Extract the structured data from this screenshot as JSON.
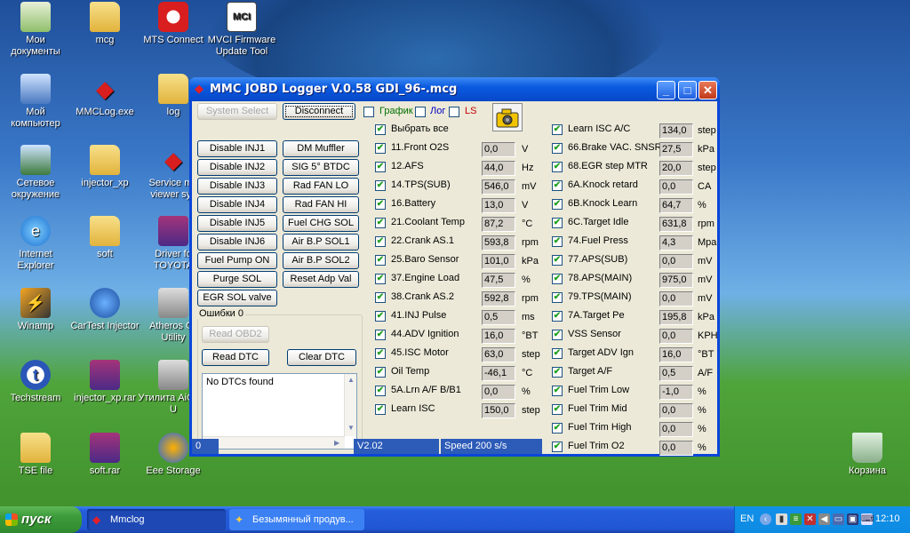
{
  "desktop": {
    "icons": [
      {
        "label": "Мои документы",
        "icon": "my-documents-icon"
      },
      {
        "label": "mcg",
        "icon": "folder-icon"
      },
      {
        "label": "MTS Connect",
        "icon": "mts-connect-icon"
      },
      {
        "label": "MVCI Firmware Update Tool",
        "icon": "mvci-icon"
      },
      {
        "label": "Мой компьютер",
        "icon": "my-computer-icon"
      },
      {
        "label": "MMCLog.exe",
        "icon": "mitsubishi-icon"
      },
      {
        "label": "log",
        "icon": "folder-icon"
      },
      {
        "label": "Сетевое окружение",
        "icon": "network-icon"
      },
      {
        "label": "injector_xp",
        "icon": "folder-icon"
      },
      {
        "label": "Service ma viewer sys",
        "icon": "mitsubishi-icon"
      },
      {
        "label": "Internet Explorer",
        "icon": "internet-explorer-icon"
      },
      {
        "label": "soft",
        "icon": "folder-icon"
      },
      {
        "label": "Driver fo TOYOTA",
        "icon": "archive-icon"
      },
      {
        "label": "Winamp",
        "icon": "winamp-icon"
      },
      {
        "label": "CarTest Injector",
        "icon": "cartest-icon"
      },
      {
        "label": "Atheros Cli Utility",
        "icon": "atheros-icon"
      },
      {
        "label": "Techstream",
        "icon": "techstream-icon"
      },
      {
        "label": "injector_xp.rar",
        "icon": "archive-icon"
      },
      {
        "label": "Утилита AiGuru U",
        "icon": "utility-icon"
      },
      {
        "label": "TSE file",
        "icon": "folder-icon"
      },
      {
        "label": "soft.rar",
        "icon": "archive-icon"
      },
      {
        "label": "Eee Storage",
        "icon": "eee-storage-icon"
      },
      {
        "label": "Корзина",
        "icon": "recycle-bin-icon"
      }
    ]
  },
  "window": {
    "title": "MMC JOBD Logger V.0.58 GDI_96-.mcg",
    "minimize": "_",
    "maximize": "□",
    "close": "✕",
    "system_select": "System Select",
    "disconnect": "Disconnect",
    "grafik": "График",
    "log": "Лог",
    "ls": "LS",
    "left_buttons": [
      "Disable INJ1",
      "Disable INJ2",
      "Disable INJ3",
      "Disable INJ4",
      "Disable INJ5",
      "Disable INJ6",
      "Fuel Pump ON",
      "Purge SOL",
      "EGR SOL valve"
    ],
    "mid_buttons": [
      "DM Muffler",
      "SIG 5° BTDC",
      "Rad FAN LO",
      "Rad FAN HI",
      "Fuel CHG SOL",
      "Air B.P SOL1",
      "Air B.P SOL2",
      "Reset Adp Val"
    ],
    "errors_title": "Ошибки 0",
    "read_obd2": "Read OBD2",
    "read_dtc": "Read DTC",
    "clear_dtc": "Clear DTC",
    "dtc_text": "No DTCs found",
    "status_left": "0",
    "status_mid": "V2.02",
    "status_speed": "Speed 200 s/s",
    "select_all": "Выбрать все",
    "params_col1": [
      {
        "label": "11.Front O2S",
        "value": "0,0",
        "unit": "V"
      },
      {
        "label": "12.AFS",
        "value": "44,0",
        "unit": "Hz"
      },
      {
        "label": "14.TPS(SUB)",
        "value": "546,0",
        "unit": "mV"
      },
      {
        "label": "16.Battery",
        "value": "13,0",
        "unit": "V"
      },
      {
        "label": "21.Coolant Temp",
        "value": "87,2",
        "unit": "°C"
      },
      {
        "label": "22.Crank AS.1",
        "value": "593,8",
        "unit": "rpm"
      },
      {
        "label": "25.Baro Sensor",
        "value": "101,0",
        "unit": "kPa"
      },
      {
        "label": "37.Engine Load",
        "value": "47,5",
        "unit": "%"
      },
      {
        "label": "38.Crank AS.2",
        "value": "592,8",
        "unit": "rpm"
      },
      {
        "label": "41.INJ Pulse",
        "value": "0,5",
        "unit": "ms"
      },
      {
        "label": "44.ADV Ignition",
        "value": "16,0",
        "unit": "°BT"
      },
      {
        "label": "45.ISC Motor",
        "value": "63,0",
        "unit": "step"
      },
      {
        "label": "Oil Temp",
        "value": "-46,1",
        "unit": "°C"
      },
      {
        "label": "5A.Lrn A/F B/B1",
        "value": "0,0",
        "unit": "%"
      },
      {
        "label": "Learn ISC",
        "value": "150,0",
        "unit": "step"
      }
    ],
    "params_col2": [
      {
        "label": "Learn ISC A/C",
        "value": "134,0",
        "unit": "step"
      },
      {
        "label": "66.Brake VAC. SNSR",
        "value": "27,5",
        "unit": "kPa"
      },
      {
        "label": "68.EGR step MTR",
        "value": "20,0",
        "unit": "step"
      },
      {
        "label": "6A.Knock retard",
        "value": "0,0",
        "unit": "CA"
      },
      {
        "label": "6B.Knock Learn",
        "value": "64,7",
        "unit": "%"
      },
      {
        "label": "6C.Target Idle",
        "value": "631,8",
        "unit": "rpm"
      },
      {
        "label": "74.Fuel Press",
        "value": "4,3",
        "unit": "Mpa"
      },
      {
        "label": "77.APS(SUB)",
        "value": "0,0",
        "unit": "mV"
      },
      {
        "label": "78.APS(MAIN)",
        "value": "975,0",
        "unit": "mV"
      },
      {
        "label": "79.TPS(MAIN)",
        "value": "0,0",
        "unit": "mV"
      },
      {
        "label": "7A.Target Pe",
        "value": "195,8",
        "unit": "kPa"
      },
      {
        "label": "VSS Sensor",
        "value": "0,0",
        "unit": "KPH"
      },
      {
        "label": "Target ADV Ign",
        "value": "16,0",
        "unit": "°BT"
      },
      {
        "label": "Target A/F",
        "value": "0,5",
        "unit": "A/F"
      },
      {
        "label": "Fuel Trim Low",
        "value": "-1,0",
        "unit": "%"
      },
      {
        "label": "Fuel Trim Mid",
        "value": "0,0",
        "unit": "%"
      },
      {
        "label": "Fuel Trim High",
        "value": "0,0",
        "unit": "%"
      },
      {
        "label": "Fuel Trim O2",
        "value": "0,0",
        "unit": "%"
      }
    ]
  },
  "taskbar": {
    "start": "пуск",
    "tasks": [
      {
        "label": "Mmclog",
        "active": true
      },
      {
        "label": "Безымянный продув...",
        "active": false
      }
    ],
    "lang": "EN",
    "clock": "12:10"
  },
  "colors": {
    "title_blue": "#0a5ae0",
    "taskbar_blue": "#245edb",
    "start_green": "#3c9a3a",
    "check_green": "#21a121",
    "ls_red": "#c00000",
    "log_blue": "#0000c0",
    "grafik_green": "#007000"
  }
}
